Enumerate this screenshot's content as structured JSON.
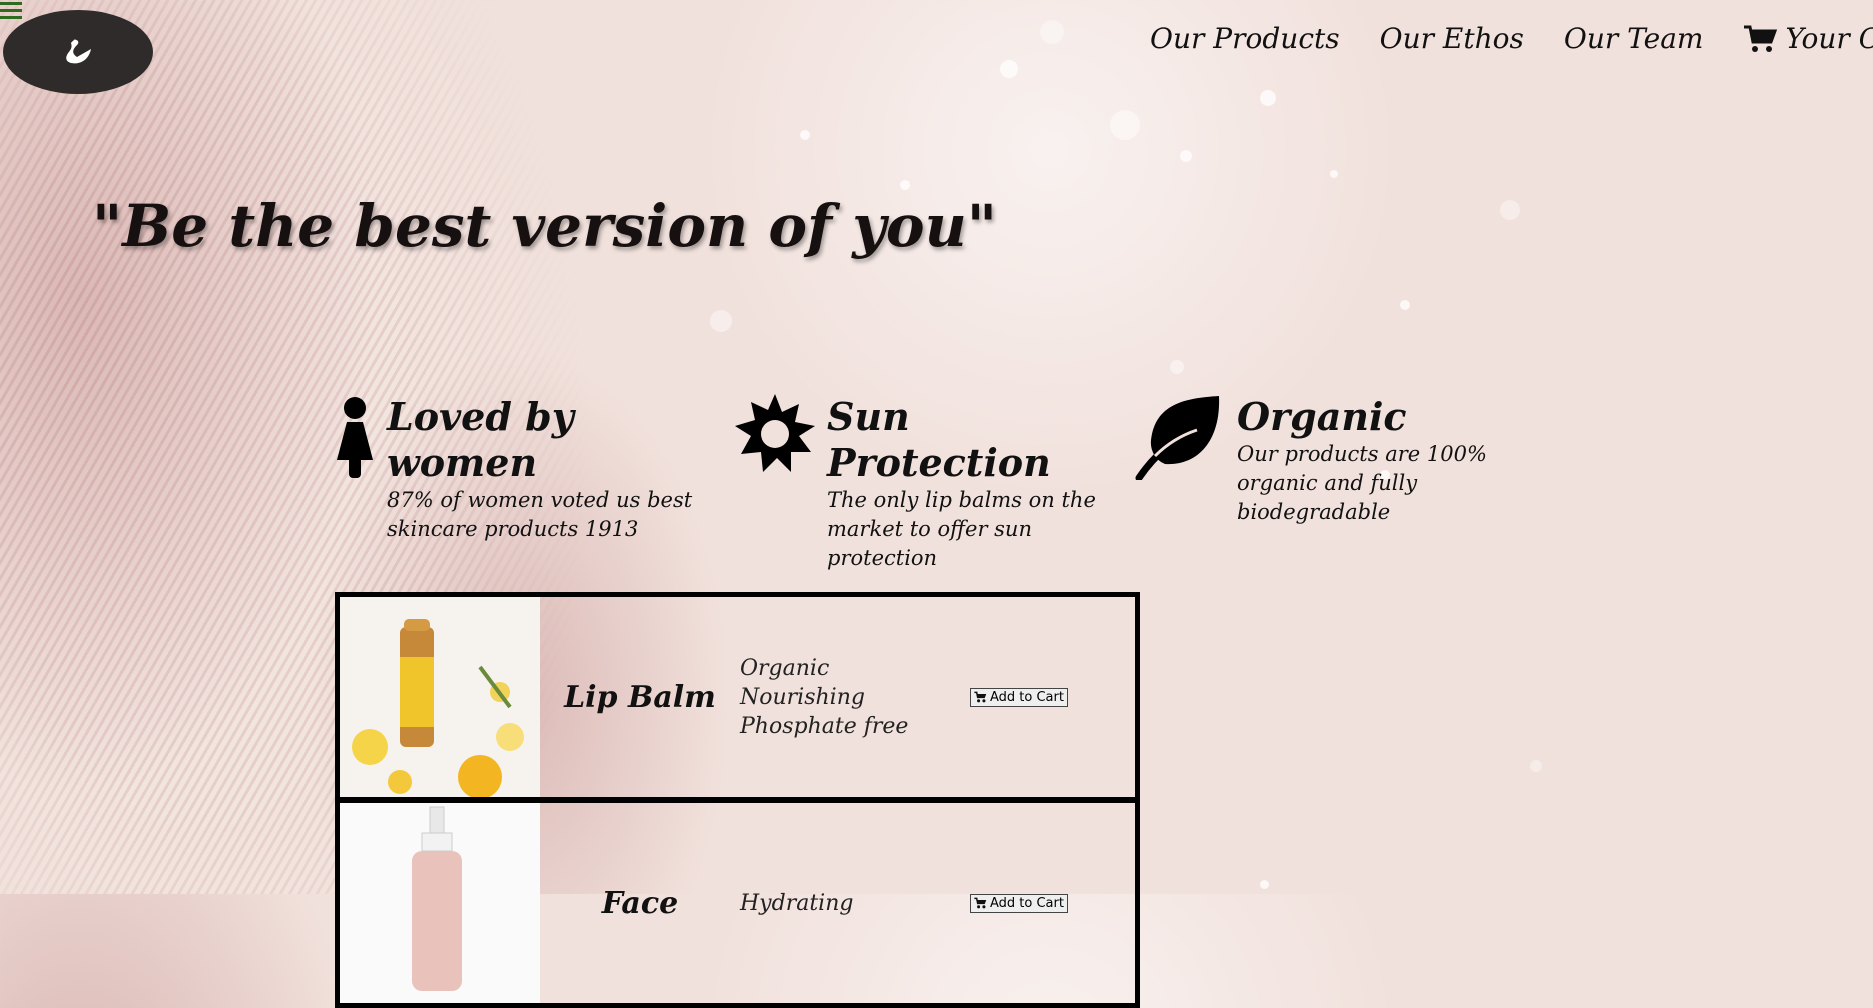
{
  "nav": {
    "items": [
      {
        "label": "Our Products"
      },
      {
        "label": "Our Ethos"
      },
      {
        "label": "Our Team"
      },
      {
        "label": "Your Cart",
        "icon": "cart-icon"
      }
    ]
  },
  "logo": {
    "icon": "swan-icon"
  },
  "hero": {
    "tagline": "\"Be the best version of you\""
  },
  "features": [
    {
      "icon": "woman-icon",
      "title": "Loved by women",
      "desc": "87% of women voted us best skincare products 1913"
    },
    {
      "icon": "sun-icon",
      "title": "Sun Protection",
      "desc": "The only lip balms on the market to offer sun protection"
    },
    {
      "icon": "leaf-icon",
      "title": "Organic",
      "desc": "Our products are 100% organic and fully biodegradable"
    }
  ],
  "products": [
    {
      "name": "Lip Balm",
      "features": [
        "Organic",
        "Nourishing",
        "Phosphate free"
      ],
      "button": "Add to Cart"
    },
    {
      "name": "Face",
      "features": [
        "Hydrating"
      ],
      "button": "Add to Cart"
    }
  ],
  "colors": {
    "background": "#f1e1dc",
    "logo_bg": "#2f2b2b",
    "hamburger": "#2e6b1f",
    "text": "#111111"
  }
}
